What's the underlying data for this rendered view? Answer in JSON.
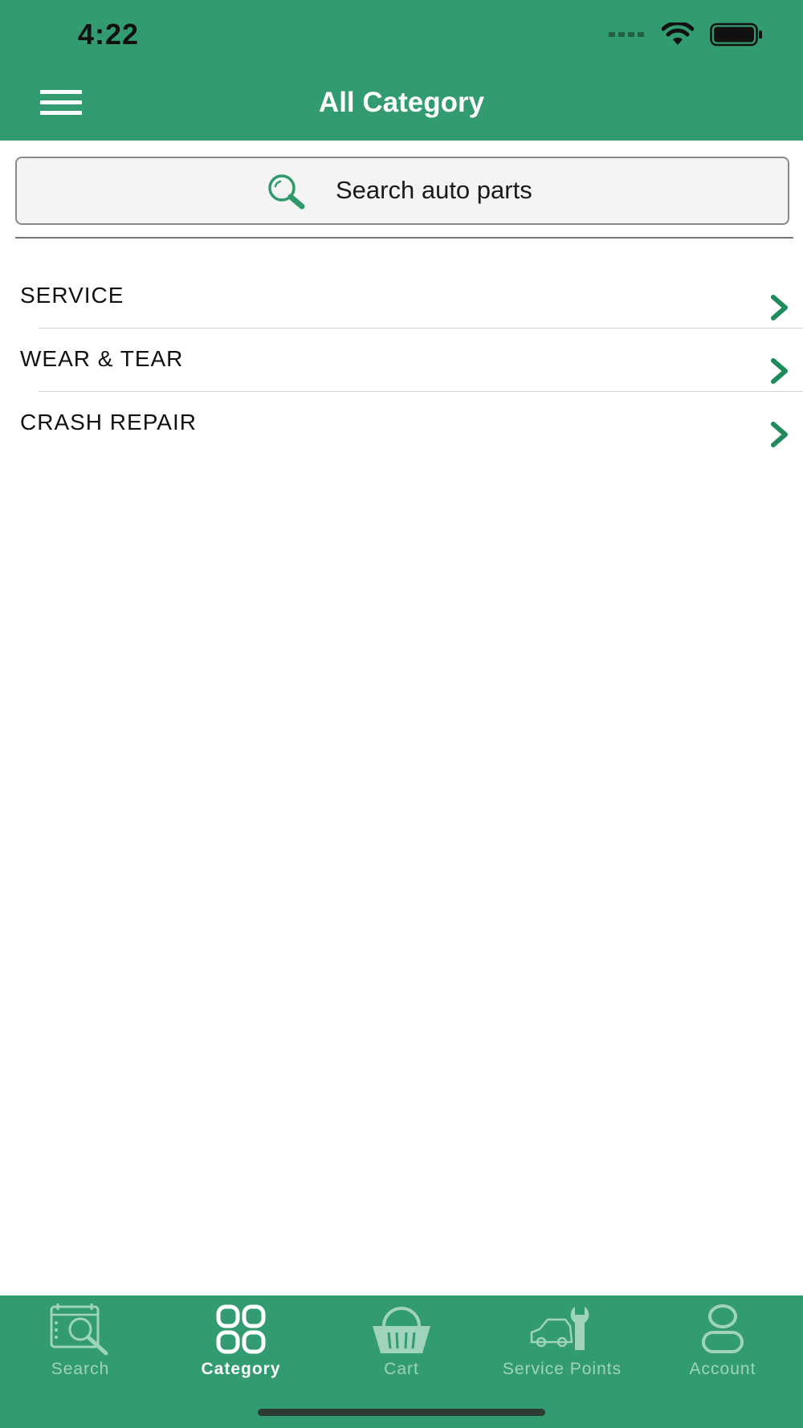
{
  "status_bar": {
    "time": "4:22"
  },
  "header": {
    "title": "All Category",
    "menu_icon": "hamburger-icon"
  },
  "search": {
    "placeholder": "Search auto parts",
    "icon": "search-icon"
  },
  "categories": [
    {
      "label": "SERVICE"
    },
    {
      "label": "WEAR & TEAR"
    },
    {
      "label": "CRASH REPAIR"
    }
  ],
  "tabbar": {
    "active_tab": "Category",
    "tabs": [
      {
        "label": "Search",
        "icon": "search-catalog-icon"
      },
      {
        "label": "Category",
        "icon": "category-grid-icon"
      },
      {
        "label": "Cart",
        "icon": "cart-basket-icon"
      },
      {
        "label": "Service Points",
        "icon": "car-wrench-icon"
      },
      {
        "label": "Account",
        "icon": "account-icon"
      }
    ]
  },
  "colors": {
    "brand_green": "#329b6f",
    "chevron_green": "#1f8a5c",
    "inactive_tab": "#9fd3bb"
  }
}
